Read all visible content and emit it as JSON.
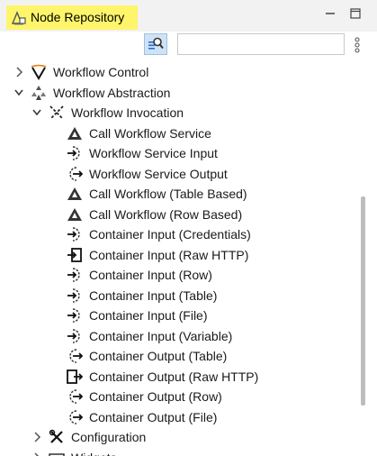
{
  "tab": {
    "title": "Node Repository"
  },
  "search": {
    "placeholder": "",
    "value": ""
  },
  "tree": [
    {
      "label": "Workflow Control",
      "state": "collapsed",
      "icon": "workflow-control-icon"
    },
    {
      "label": "Workflow Abstraction",
      "state": "expanded",
      "icon": "workflow-abstraction-icon"
    },
    {
      "label": "Workflow Invocation",
      "state": "expanded",
      "icon": "workflow-invocation-icon"
    },
    {
      "label": "Call Workflow Service",
      "icon": "call-workflow-icon"
    },
    {
      "label": "Workflow Service Input",
      "icon": "service-input-icon"
    },
    {
      "label": "Workflow Service Output",
      "icon": "service-output-icon"
    },
    {
      "label": "Call Workflow (Table Based)",
      "icon": "call-workflow-icon"
    },
    {
      "label": "Call Workflow (Row Based)",
      "icon": "call-workflow-icon"
    },
    {
      "label": "Container Input (Credentials)",
      "icon": "container-input-icon"
    },
    {
      "label": "Container Input (Raw HTTP)",
      "icon": "raw-http-input-icon"
    },
    {
      "label": "Container Input (Row)",
      "icon": "container-input-icon"
    },
    {
      "label": "Container Input (Table)",
      "icon": "container-input-icon"
    },
    {
      "label": "Container Input (File)",
      "icon": "container-input-icon"
    },
    {
      "label": "Container Input (Variable)",
      "icon": "container-input-icon"
    },
    {
      "label": "Container Output (Table)",
      "icon": "container-output-icon"
    },
    {
      "label": "Container Output (Raw HTTP)",
      "icon": "raw-http-output-icon"
    },
    {
      "label": "Container Output (Row)",
      "icon": "container-output-icon"
    },
    {
      "label": "Container Output (File)",
      "icon": "container-output-icon"
    },
    {
      "label": "Configuration",
      "state": "collapsed",
      "icon": "configuration-icon"
    },
    {
      "label": "Widgets",
      "state": "collapsed",
      "icon": "widgets-icon"
    }
  ],
  "colors": {
    "tab_highlight": "#fff56a",
    "scroll_thumb": "#bdbdbd",
    "search_button": "#cfe3f7"
  }
}
